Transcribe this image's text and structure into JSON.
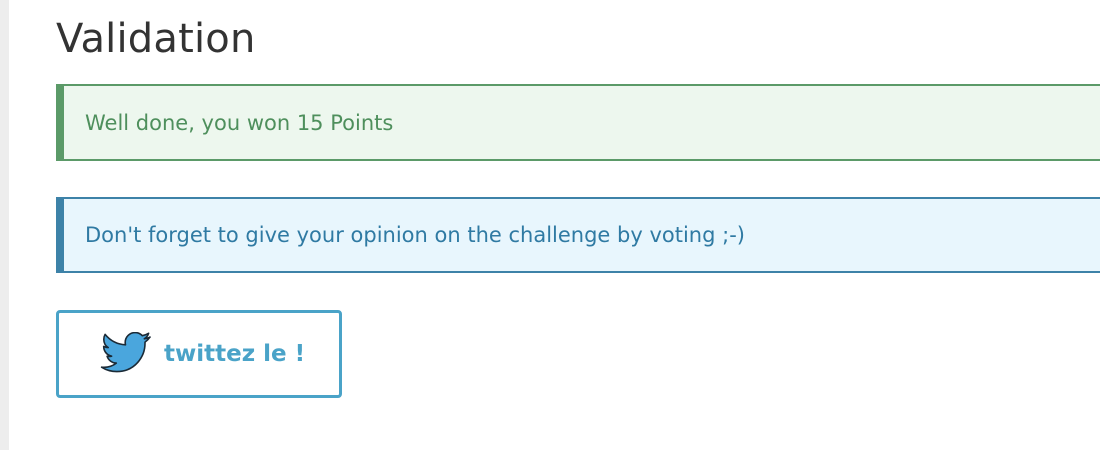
{
  "page": {
    "title": "Validation"
  },
  "alerts": {
    "success": {
      "text": "Well done, you won 15 Points",
      "color": "#4e8f5c",
      "background": "#edf7ee"
    },
    "info": {
      "text": "Don't forget to give your opinion on the challenge by voting ;-)",
      "color": "#2f7aa3",
      "background": "#e8f6fd"
    }
  },
  "tweet_button": {
    "label": "twittez le !",
    "icon": "twitter-bird-icon",
    "accent": "#4aa3c8"
  }
}
